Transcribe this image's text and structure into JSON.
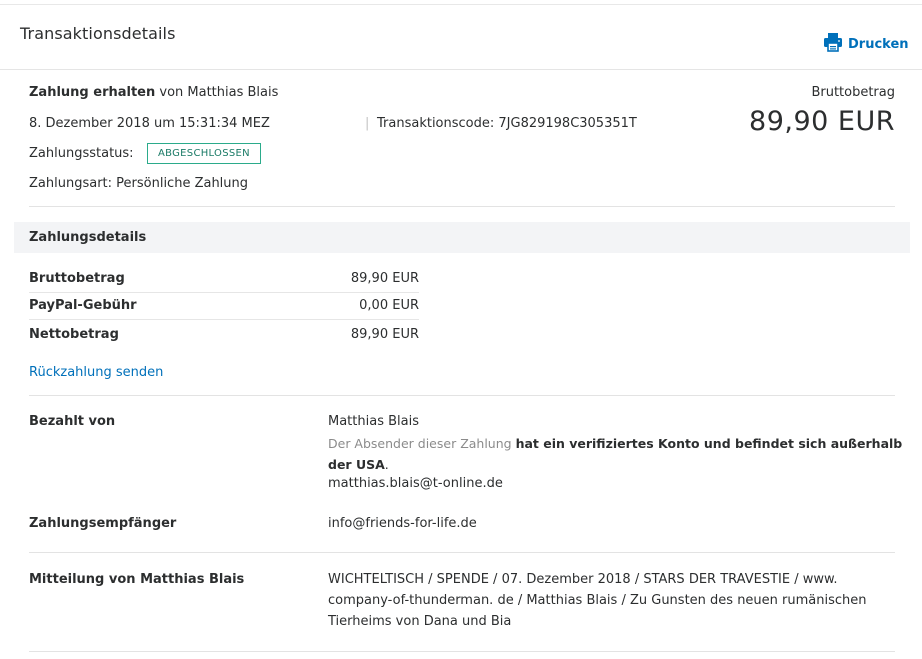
{
  "header": {
    "title": "Transaktionsdetails",
    "print_label": "Drucken"
  },
  "summary": {
    "status_line_bold": "Zahlung erhalten",
    "status_line_rest": " von Matthias Blais",
    "date": "8. Dezember 2018 um 15:31:34 MEZ",
    "transaction_code": "Transaktionscode: 7JG829198C305351T",
    "payment_status_label": "Zahlungsstatus:",
    "payment_status_badge": "ABGESCHLOSSEN",
    "payment_type": "Zahlungsart: Persönliche Zahlung",
    "gross_label": "Bruttobetrag",
    "gross_amount": "89,90 EUR"
  },
  "details": {
    "section_title": "Zahlungsdetails",
    "rows": [
      {
        "label": "Bruttobetrag",
        "value": "89,90 EUR"
      },
      {
        "label": "PayPal-Gebühr",
        "value": "0,00 EUR"
      },
      {
        "label": "Nettobetrag",
        "value": "89,90 EUR"
      }
    ],
    "refund_link": "Rückzahlung senden"
  },
  "paid_by": {
    "label": "Bezahlt von",
    "name": "Matthias Blais",
    "note_grey": "Der Absender dieser Zahlung ",
    "note_bold": "hat ein verifiziertes Konto und befindet sich außerhalb der USA",
    "note_end": ".",
    "email": "matthias.blais@t-online.de"
  },
  "recipient": {
    "label": "Zahlungsempfänger",
    "email": "info@friends-for-life.de"
  },
  "message": {
    "label": "Mitteilung von Matthias Blais",
    "text": "WICHTELTISCH / SPENDE / 07. Dezember 2018 / STARS DER TRAVESTIE / www. company-of-thunderman. de / Matthias Blais / Zu Gunsten des neuen rumänischen Tierheims von Dana und Bia"
  }
}
